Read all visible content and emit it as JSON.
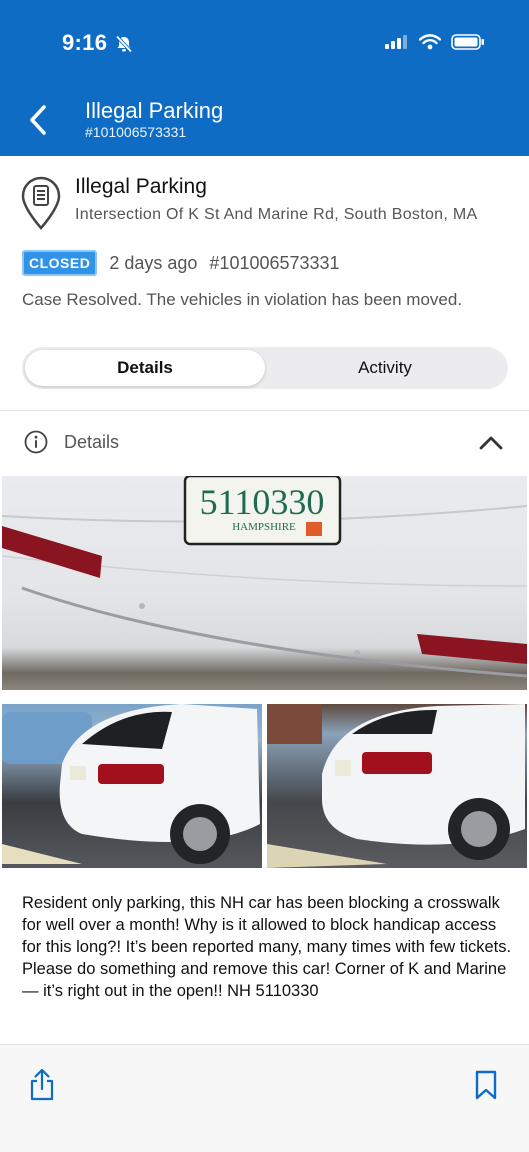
{
  "status_bar": {
    "time": "9:16"
  },
  "header": {
    "title": "Illegal Parking",
    "case_number": "#101006573331"
  },
  "case": {
    "title": "Illegal Parking",
    "address": "Intersection Of K St And Marine Rd, South Boston, MA",
    "status": "CLOSED",
    "age": "2 days ago",
    "number": "#101006573331",
    "resolution": "Case Resolved. The vehicles in violation has been moved."
  },
  "tabs": [
    {
      "label": "Details",
      "active": true
    },
    {
      "label": "Activity",
      "active": false
    }
  ],
  "details_section": {
    "label": "Details"
  },
  "photos": {
    "main_plate_text": "5110330",
    "plate_state": "HAMPSHIRE"
  },
  "description": "Resident only parking, this NH car has been blocking a crosswalk for well over a month! Why is it allowed to block handicap access for this long?! It’s been reported many, many times with few tickets. Please do something and remove this car! Corner of K and Marine— it’s right out in the open!! NH 5110330",
  "colors": {
    "header_bg": "#0f6cc4",
    "badge_bg": "#2f94e8",
    "accent": "#0f6cc4"
  },
  "icons": [
    "bell-slash-icon",
    "signal-icon",
    "wifi-icon",
    "battery-icon",
    "chevron-left-icon",
    "map-pin-document-icon",
    "info-icon",
    "chevron-up-icon",
    "share-icon",
    "bookmark-icon"
  ]
}
